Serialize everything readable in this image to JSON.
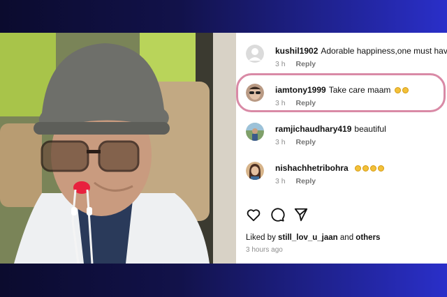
{
  "comments": [
    {
      "username": "kushil1902",
      "text": "Adorable happiness,one must have",
      "time": "3 h",
      "reply": "Reply",
      "avatar": "default-avatar-icon",
      "emoji_count": 0
    },
    {
      "username": "iamtony1999",
      "text": "Take care maam",
      "time": "3 h",
      "reply": "Reply",
      "avatar": "sunglasses-user-avatar",
      "emoji_count": 2
    },
    {
      "username": "ramjichaudhary419",
      "text": "beautiful",
      "time": "3 h",
      "reply": "Reply",
      "avatar": "outdoor-user-avatar",
      "emoji_count": 0
    },
    {
      "username": "nishachhetribohra",
      "text": "",
      "time": "3 h",
      "reply": "Reply",
      "avatar": "woman-user-avatar",
      "emoji_count": 4
    }
  ],
  "actions": {
    "like": "heart-icon",
    "comment": "comment-icon",
    "share": "send-icon"
  },
  "likes": {
    "prefix": "Liked by",
    "user": "still_lov_u_jaan",
    "conjunction": "and",
    "others": "others"
  },
  "post_time": "3 hours ago",
  "colors": {
    "highlight": "#d98aa6",
    "meta": "#8e8e8e",
    "background_left": "#0b0b2e",
    "background_right": "#2a2fc9"
  }
}
